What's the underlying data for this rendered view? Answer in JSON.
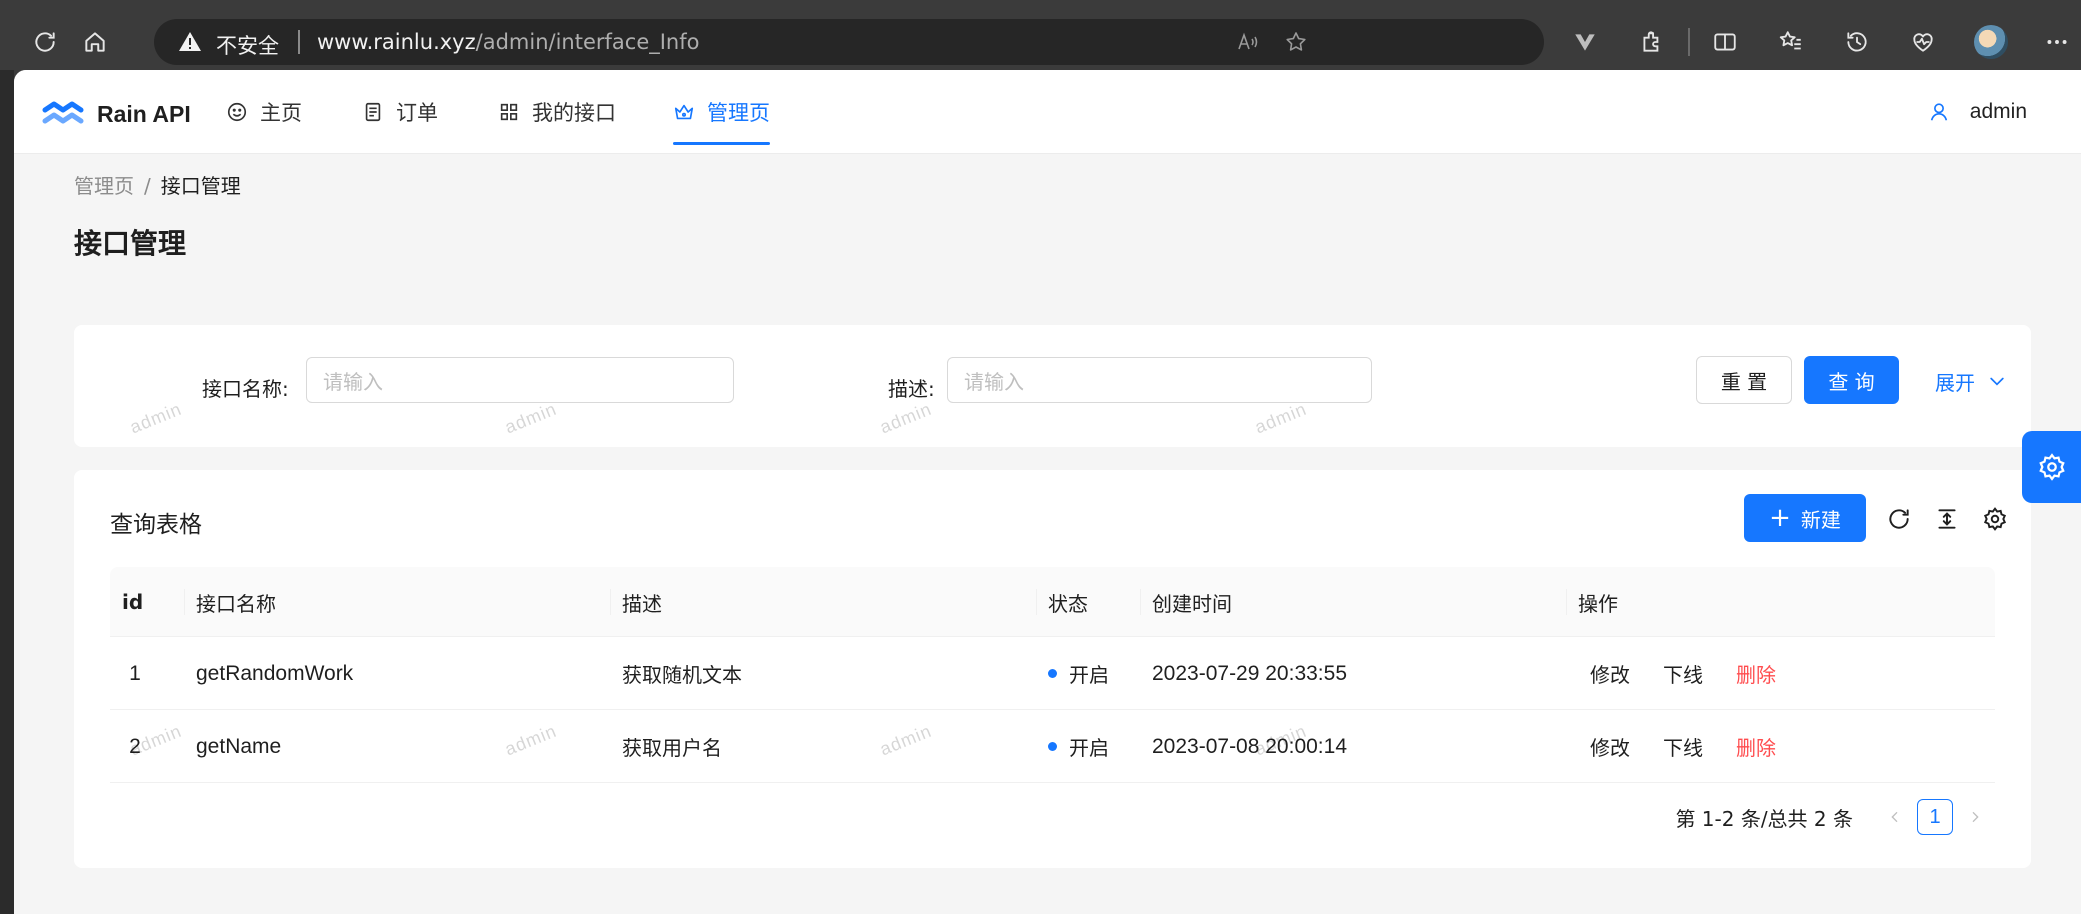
{
  "browser": {
    "insecure_label": "不安全",
    "url_host": "www.rainlu.xyz",
    "url_path": "/admin/interface_Info"
  },
  "app": {
    "brand": "Rain API",
    "nav": [
      {
        "label": "主页",
        "icon": "smile-icon"
      },
      {
        "label": "订单",
        "icon": "document-icon"
      },
      {
        "label": "我的接口",
        "icon": "grid-icon"
      },
      {
        "label": "管理页",
        "icon": "crown-icon",
        "active": true
      }
    ],
    "user": "admin"
  },
  "breadcrumb": {
    "parent": "管理页",
    "separator": "/",
    "current": "接口管理"
  },
  "page_title": "接口管理",
  "search": {
    "name_label": "接口名称:",
    "name_placeholder": "请输入",
    "desc_label": "描述:",
    "desc_placeholder": "请输入",
    "reset_label": "重 置",
    "query_label": "查 询",
    "expand_label": "展开"
  },
  "table": {
    "title": "查询表格",
    "new_label": "新建",
    "columns": [
      "id",
      "接口名称",
      "描述",
      "状态",
      "创建时间",
      "操作"
    ],
    "rows": [
      {
        "id": "1",
        "name": "getRandomWork",
        "desc": "获取随机文本",
        "status": "开启",
        "created": "2023-07-29 20:33:55",
        "actions": {
          "edit": "修改",
          "offline": "下线",
          "delete": "删除"
        }
      },
      {
        "id": "2",
        "name": "getName",
        "desc": "获取用户名",
        "status": "开启",
        "created": "2023-07-08 20:00:14",
        "actions": {
          "edit": "修改",
          "offline": "下线",
          "delete": "删除"
        }
      }
    ],
    "pagination": {
      "total_text": "第 1-2 条/总共 2 条",
      "current_page": "1"
    }
  },
  "watermark": "admin",
  "colors": {
    "primary": "#1677ff",
    "danger": "#ff4d4f"
  }
}
